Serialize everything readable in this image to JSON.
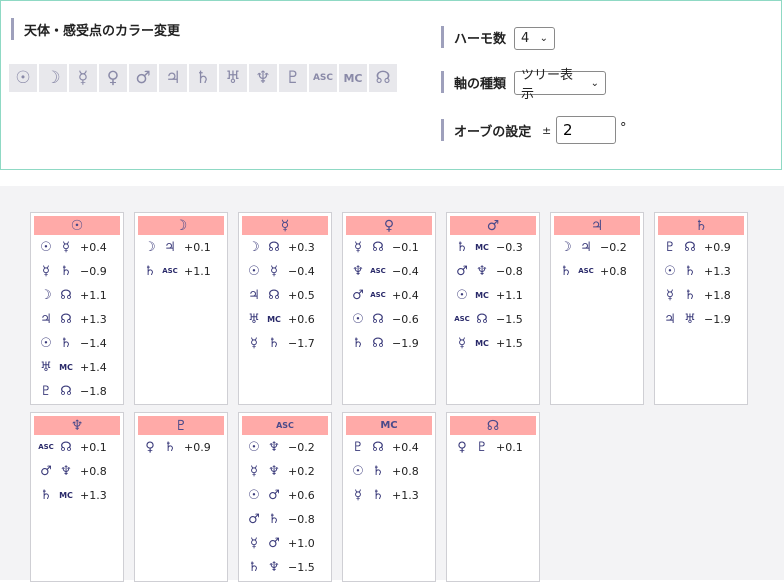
{
  "settings": {
    "color_title": "天体・感受点のカラー変更",
    "harmonic_label": "ハーモ数",
    "harmonic_value": "4",
    "axis_label": "軸の種類",
    "axis_value": "ツリー表示",
    "orb_label": "オーブの設定",
    "orb_pm": "±",
    "orb_value": "2",
    "orb_unit": "°"
  },
  "planet_buttons": [
    {
      "glyph": "☉",
      "name": "sun"
    },
    {
      "glyph": "☽",
      "name": "moon"
    },
    {
      "glyph": "☿",
      "name": "mercury"
    },
    {
      "glyph": "♀",
      "name": "venus"
    },
    {
      "glyph": "♂",
      "name": "mars"
    },
    {
      "glyph": "♃",
      "name": "jupiter"
    },
    {
      "glyph": "♄",
      "name": "saturn"
    },
    {
      "glyph": "♅",
      "name": "uranus"
    },
    {
      "glyph": "♆",
      "name": "neptune"
    },
    {
      "glyph": "♇",
      "name": "pluto"
    },
    {
      "glyph": "ASC",
      "name": "asc"
    },
    {
      "glyph": "MC",
      "name": "mc"
    },
    {
      "glyph": "☊",
      "name": "node"
    }
  ],
  "cards": [
    {
      "head": "☉",
      "name": "sun",
      "rows": [
        [
          "☉",
          "☿",
          "+0.4"
        ],
        [
          "☿",
          "♄",
          "−0.9"
        ],
        [
          "☽",
          "☊",
          "+1.1"
        ],
        [
          "♃",
          "☊",
          "+1.3"
        ],
        [
          "☉",
          "♄",
          "−1.4"
        ],
        [
          "♅",
          "MC",
          "+1.4"
        ],
        [
          "♇",
          "☊",
          "−1.8"
        ]
      ]
    },
    {
      "head": "☽",
      "name": "moon",
      "rows": [
        [
          "☽",
          "♃",
          "+0.1"
        ],
        [
          "♄",
          "ASC",
          "+1.1"
        ]
      ]
    },
    {
      "head": "☿",
      "name": "mercury",
      "rows": [
        [
          "☽",
          "☊",
          "+0.3"
        ],
        [
          "☉",
          "☿",
          "−0.4"
        ],
        [
          "♃",
          "☊",
          "+0.5"
        ],
        [
          "♅",
          "MC",
          "+0.6"
        ],
        [
          "☿",
          "♄",
          "−1.7"
        ]
      ]
    },
    {
      "head": "♀",
      "name": "venus",
      "rows": [
        [
          "☿",
          "☊",
          "−0.1"
        ],
        [
          "♆",
          "ASC",
          "−0.4"
        ],
        [
          "♂",
          "ASC",
          "+0.4"
        ],
        [
          "☉",
          "☊",
          "−0.6"
        ],
        [
          "♄",
          "☊",
          "−1.9"
        ]
      ]
    },
    {
      "head": "♂",
      "name": "mars",
      "rows": [
        [
          "♄",
          "MC",
          "−0.3"
        ],
        [
          "♂",
          "♆",
          "−0.8"
        ],
        [
          "☉",
          "MC",
          "+1.1"
        ],
        [
          "ASC",
          "☊",
          "−1.5"
        ],
        [
          "☿",
          "MC",
          "+1.5"
        ]
      ]
    },
    {
      "head": "♃",
      "name": "jupiter",
      "rows": [
        [
          "☽",
          "♃",
          "−0.2"
        ],
        [
          "♄",
          "ASC",
          "+0.8"
        ]
      ]
    },
    {
      "head": "♄",
      "name": "saturn",
      "rows": [
        [
          "♇",
          "☊",
          "+0.9"
        ],
        [
          "☉",
          "♄",
          "+1.3"
        ],
        [
          "☿",
          "♄",
          "+1.8"
        ],
        [
          "♃",
          "♅",
          "−1.9"
        ]
      ]
    },
    {
      "head": "♆",
      "name": "neptune",
      "rows": [
        [
          "ASC",
          "☊",
          "+0.1"
        ],
        [
          "♂",
          "♆",
          "+0.8"
        ],
        [
          "♄",
          "MC",
          "+1.3"
        ]
      ]
    },
    {
      "head": "♇",
      "name": "pluto",
      "rows": [
        [
          "♀",
          "♄",
          "+0.9"
        ]
      ]
    },
    {
      "head": "ASC",
      "name": "asc",
      "rows": [
        [
          "☉",
          "♆",
          "−0.2"
        ],
        [
          "☿",
          "♆",
          "+0.2"
        ],
        [
          "☉",
          "♂",
          "+0.6"
        ],
        [
          "♂",
          "♄",
          "−0.8"
        ],
        [
          "☿",
          "♂",
          "+1.0"
        ],
        [
          "♄",
          "♆",
          "−1.5"
        ]
      ]
    },
    {
      "head": "MC",
      "name": "mc",
      "rows": [
        [
          "♇",
          "☊",
          "+0.4"
        ],
        [
          "☉",
          "♄",
          "+0.8"
        ],
        [
          "☿",
          "♄",
          "+1.3"
        ]
      ]
    },
    {
      "head": "☊",
      "name": "node",
      "rows": [
        [
          "♀",
          "♇",
          "+0.1"
        ]
      ]
    }
  ]
}
